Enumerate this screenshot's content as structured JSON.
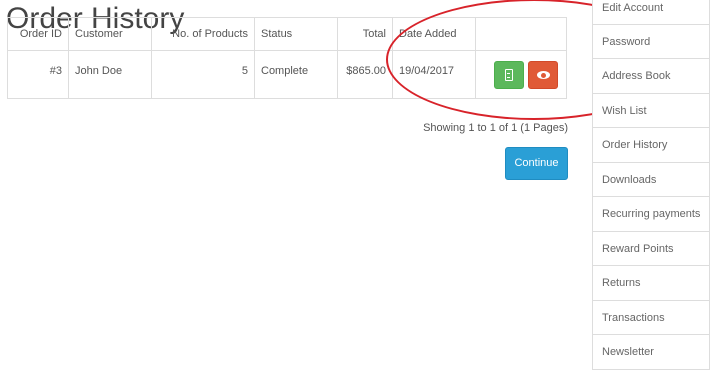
{
  "page": {
    "title": "Order History"
  },
  "table": {
    "headers": {
      "order_id": "Order ID",
      "customer": "Customer",
      "products": "No. of Products",
      "status": "Status",
      "total": "Total",
      "date_added": "Date Added"
    },
    "rows": [
      {
        "order_id": "#3",
        "customer": "John Doe",
        "products": "5",
        "status": "Complete",
        "total": "$865.00",
        "date_added": "19/04/2017",
        "actions": {
          "invoice_icon": "pdf-icon",
          "view_icon": "eye-icon"
        }
      }
    ]
  },
  "pagination": {
    "text": "Showing 1 to 1 of 1 (1 Pages)"
  },
  "continue_label": "Continue",
  "sidebar": {
    "items": [
      {
        "label": "Edit Account"
      },
      {
        "label": "Password"
      },
      {
        "label": "Address Book"
      },
      {
        "label": "Wish List"
      },
      {
        "label": "Order History"
      },
      {
        "label": "Downloads"
      },
      {
        "label": "Recurring payments"
      },
      {
        "label": "Reward Points"
      },
      {
        "label": "Returns"
      },
      {
        "label": "Transactions"
      },
      {
        "label": "Newsletter"
      }
    ]
  },
  "colors": {
    "invoice_button": "#5cb85c",
    "view_button": "#e05a37",
    "continue_button": "#2a9fd6",
    "annotation": "#d8232a"
  }
}
